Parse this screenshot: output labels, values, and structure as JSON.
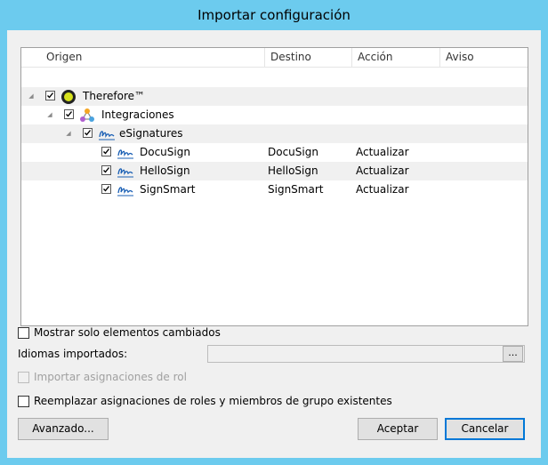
{
  "window": {
    "title": "Importar configuración"
  },
  "tree": {
    "columns": [
      "Origen",
      "Destino",
      "Acción",
      "Aviso"
    ],
    "rows": [
      {
        "label": "Therefore™",
        "destino": "",
        "accion": "",
        "aviso": "",
        "icon": "therefore-logo-icon",
        "checked": true
      },
      {
        "label": "Integraciones",
        "destino": "",
        "accion": "",
        "aviso": "",
        "icon": "integrations-icon",
        "checked": true
      },
      {
        "label": "eSignatures",
        "destino": "",
        "accion": "",
        "aviso": "",
        "icon": "signature-icon",
        "checked": true
      },
      {
        "label": "DocuSign",
        "destino": "DocuSign",
        "accion": "Actualizar",
        "aviso": "",
        "icon": "signature-icon",
        "checked": true
      },
      {
        "label": "HelloSign",
        "destino": "HelloSign",
        "accion": "Actualizar",
        "aviso": "",
        "icon": "signature-icon",
        "checked": true
      },
      {
        "label": "SignSmart",
        "destino": "SignSmart",
        "accion": "Actualizar",
        "aviso": "",
        "icon": "signature-icon",
        "checked": true
      }
    ]
  },
  "options": {
    "show_changed_only": {
      "label": "Mostrar solo elementos cambiados",
      "checked": false
    },
    "languages_label": "Idiomas importados:",
    "languages_value": "",
    "browse_label": "...",
    "import_roles": {
      "label": "Importar asignaciones de rol",
      "checked": false,
      "disabled": true
    },
    "replace_roles": {
      "label": "Reemplazar asignaciones de roles y miembros de grupo existentes",
      "checked": false
    }
  },
  "buttons": {
    "advanced": "Avanzado...",
    "accept": "Aceptar",
    "cancel": "Cancelar"
  },
  "colors": {
    "window_frame": "#6ccbee",
    "dialog_bg": "#f0f0f0",
    "default_button_border": "#0078d7",
    "signature_icon": "#1a5fb4"
  }
}
